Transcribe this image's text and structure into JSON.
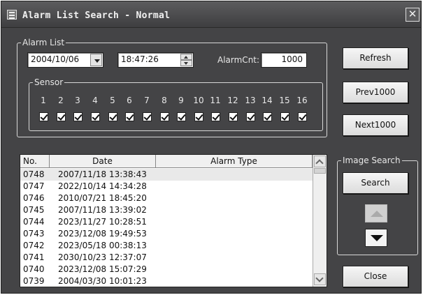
{
  "window": {
    "title": "Alarm List Search - Normal",
    "close_glyph": "✕"
  },
  "alarm_list": {
    "group_label": "Alarm List",
    "date_value": "2004/10/06",
    "time_value": "18:47:26",
    "alarm_cnt_label": "AlarmCnt:",
    "alarm_cnt_value": "1000"
  },
  "sensor": {
    "group_label": "Sensor",
    "numbers": [
      "1",
      "2",
      "3",
      "4",
      "5",
      "6",
      "7",
      "8",
      "9",
      "10",
      "11",
      "12",
      "13",
      "14",
      "15",
      "16"
    ],
    "checked": [
      true,
      true,
      true,
      true,
      true,
      true,
      true,
      true,
      true,
      true,
      true,
      true,
      true,
      true,
      true,
      true
    ]
  },
  "buttons": {
    "refresh": "Refresh",
    "prev": "Prev1000",
    "next": "Next1000",
    "search": "Search",
    "close": "Close"
  },
  "image_search": {
    "group_label": "Image Search"
  },
  "table": {
    "headers": {
      "no": "No.",
      "date": "Date",
      "type": "Alarm Type"
    },
    "rows": [
      {
        "no": "0748",
        "date": "2007/11/18 13:38:43",
        "type": ""
      },
      {
        "no": "0747",
        "date": "2022/10/14 14:34:28",
        "type": ""
      },
      {
        "no": "0746",
        "date": "2010/07/21 18:45:20",
        "type": ""
      },
      {
        "no": "0745",
        "date": "2007/11/18 13:39:02",
        "type": ""
      },
      {
        "no": "0744",
        "date": "2023/11/27 10:28:51",
        "type": ""
      },
      {
        "no": "0743",
        "date": "2023/12/08 19:49:53",
        "type": ""
      },
      {
        "no": "0742",
        "date": "2023/05/18 00:38:13",
        "type": ""
      },
      {
        "no": "0741",
        "date": "2030/10/23 12:37:07",
        "type": ""
      },
      {
        "no": "0740",
        "date": "2023/12/08 15:07:29",
        "type": ""
      },
      {
        "no": "0739",
        "date": "2004/03/30 10:01:23",
        "type": ""
      }
    ]
  },
  "icons": {
    "app": "app-window-icon",
    "close": "close-icon",
    "dropdown": "chevron-down-icon",
    "spin": "spinner-icon",
    "image_up": "arrow-up-icon",
    "image_down": "arrow-down-icon"
  },
  "colors": {
    "window_bg": "#444446",
    "titlebar_bg": "#4a4a4c",
    "text_light": "#e8e8e8",
    "field_bg": "#ffffff"
  }
}
